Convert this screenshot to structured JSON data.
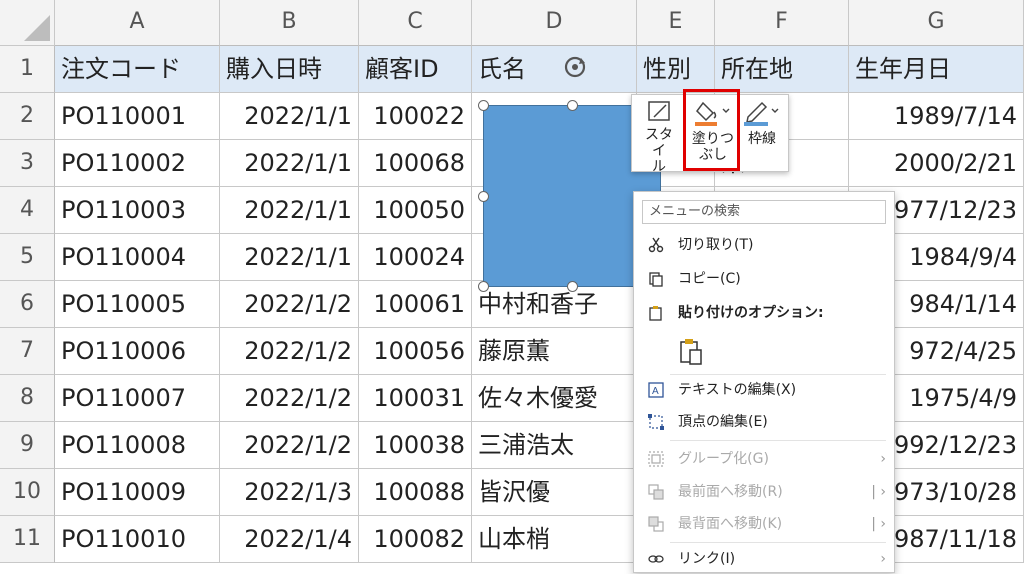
{
  "columns": [
    "A",
    "B",
    "C",
    "D",
    "E",
    "F",
    "G"
  ],
  "rows": [
    {
      "n": "1",
      "a": "注文コード",
      "b": "購入日時",
      "c": "顧客ID",
      "d": "氏名",
      "e": "性別",
      "f": "所在地",
      "g": "生年月日"
    },
    {
      "n": "2",
      "a": "PO110001",
      "b": "2022/1/1",
      "c": "100022",
      "d": "",
      "e": "",
      "f": "県",
      "g": "1989/7/14"
    },
    {
      "n": "3",
      "a": "PO110002",
      "b": "2022/1/1",
      "c": "100068",
      "d": "",
      "e": "",
      "f": "県",
      "g": "2000/2/21"
    },
    {
      "n": "4",
      "a": "PO110003",
      "b": "2022/1/1",
      "c": "100050",
      "d": "",
      "e": "",
      "f": "",
      "g": "977/12/23"
    },
    {
      "n": "5",
      "a": "PO110004",
      "b": "2022/1/1",
      "c": "100024",
      "d": "",
      "e": "",
      "f": "",
      "g": "1984/9/4"
    },
    {
      "n": "6",
      "a": "PO110005",
      "b": "2022/1/2",
      "c": "100061",
      "d": "中村和香子",
      "e": "",
      "f": "",
      "g": "984/1/14"
    },
    {
      "n": "7",
      "a": "PO110006",
      "b": "2022/1/2",
      "c": "100056",
      "d": "藤原薫",
      "e": "",
      "f": "",
      "g": "972/4/25"
    },
    {
      "n": "8",
      "a": "PO110007",
      "b": "2022/1/2",
      "c": "100031",
      "d": "佐々木優愛",
      "e": "",
      "f": "",
      "g": "1975/4/9"
    },
    {
      "n": "9",
      "a": "PO110008",
      "b": "2022/1/2",
      "c": "100038",
      "d": "三浦浩太",
      "e": "",
      "f": "",
      "g": "992/12/23"
    },
    {
      "n": "10",
      "a": "PO110009",
      "b": "2022/1/3",
      "c": "100088",
      "d": "皆沢優",
      "e": "",
      "f": "",
      "g": "973/10/28"
    },
    {
      "n": "11",
      "a": "PO110010",
      "b": "2022/1/4",
      "c": "100082",
      "d": "山本梢",
      "e": "",
      "f": "",
      "g": "987/11/18"
    }
  ],
  "mini_toolbar": {
    "style_label_1": "スタイ",
    "style_label_2": "ル",
    "fill_label_1": "塗りつ",
    "fill_label_2": "ぶし",
    "outline_label": "枠線",
    "fill_color": "#ed7d31",
    "outline_color": "#5b9bd5"
  },
  "context_menu": {
    "search_placeholder": "メニューの検索",
    "cut": "切り取り(T)",
    "copy": "コピー(C)",
    "paste_options": "貼り付けのオプション:",
    "edit_text": "テキストの編集(X)",
    "edit_points": "頂点の編集(E)",
    "group": "グループ化(G)",
    "bring_front": "最前面へ移動(R)",
    "send_back": "最背面へ移動(K)",
    "link": "リンク(I)"
  },
  "colors": {
    "header_fill": "#dde9f6",
    "shape_fill": "#5b9bd5",
    "highlight": "#e00000"
  }
}
